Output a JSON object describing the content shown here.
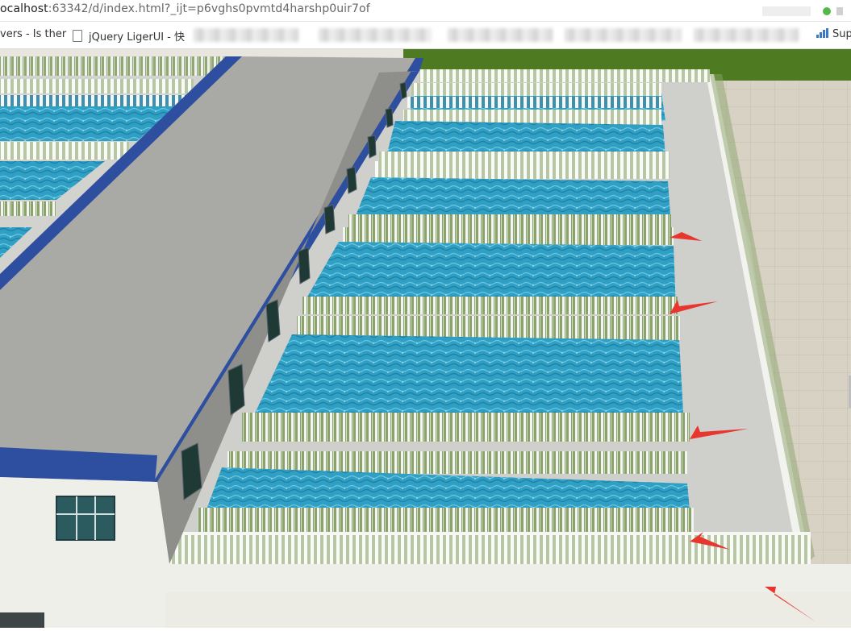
{
  "browser": {
    "url_host": "ocalhost",
    "url_rest": ":63342/d/index.html?_ijt=p6vghs0pvmtd4harshp0uir7of",
    "bookmarks": [
      {
        "label": "vers - Is ther",
        "icon": "page-icon"
      },
      {
        "label": "jQuery LigerUI - 快",
        "icon": "page-icon"
      },
      {
        "label": "Sup",
        "icon": "signal-icon"
      }
    ]
  },
  "scene": {
    "description_icon": "3d-water-treatment-plant",
    "colors": {
      "water": "#2f9fc4",
      "wall": "#d9d9d6",
      "roof": "#a9a9a6",
      "roof_trim": "#2e4ea0",
      "grass": "#4e7a22",
      "tiles": "#d8d2c5",
      "arrow": "#e8362e"
    },
    "annotation_arrows": 5
  }
}
